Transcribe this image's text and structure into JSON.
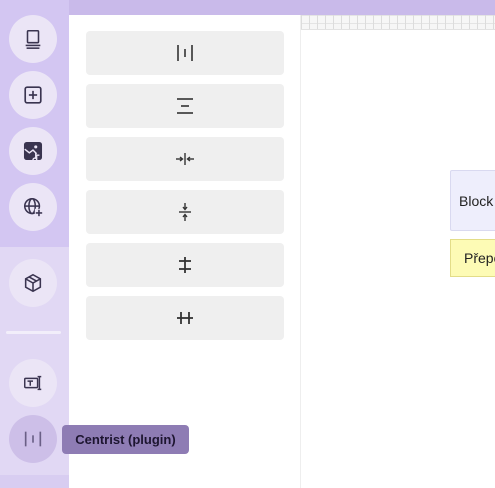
{
  "rail": {
    "buttons": [
      {
        "name": "layers",
        "icon": "layers-icon"
      },
      {
        "name": "add",
        "icon": "add-square-icon"
      },
      {
        "name": "media-library",
        "icon": "media-library-icon"
      },
      {
        "name": "web",
        "icon": "globe-add-icon"
      },
      {
        "name": "shapes",
        "icon": "box-icon"
      },
      {
        "name": "text-field",
        "icon": "text-field-icon"
      },
      {
        "name": "centrist",
        "icon": "centrist-icon",
        "active": true
      }
    ]
  },
  "panel": {
    "buttons": [
      {
        "name": "distribute-horizontal",
        "icon": "distribute-horizontal-icon"
      },
      {
        "name": "distribute-vertical",
        "icon": "distribute-vertical-icon"
      },
      {
        "name": "squeeze-horizontal",
        "icon": "squeeze-horizontal-icon"
      },
      {
        "name": "squeeze-vertical",
        "icon": "squeeze-vertical-icon"
      },
      {
        "name": "align-middle-horizontal",
        "icon": "align-middle-horizontal-icon"
      },
      {
        "name": "align-middle-vertical",
        "icon": "align-middle-vertical-icon"
      }
    ]
  },
  "canvas": {
    "block_text": "Block",
    "note_text": "Přepo"
  },
  "tooltip": {
    "text": "Centrist (plugin)"
  },
  "colors": {
    "rail": "#d3c6f2",
    "rail_button": "#ebe5f6",
    "tooltip": "#8e7cb4",
    "block": "#eeeefc",
    "note": "#fdfbb5"
  }
}
